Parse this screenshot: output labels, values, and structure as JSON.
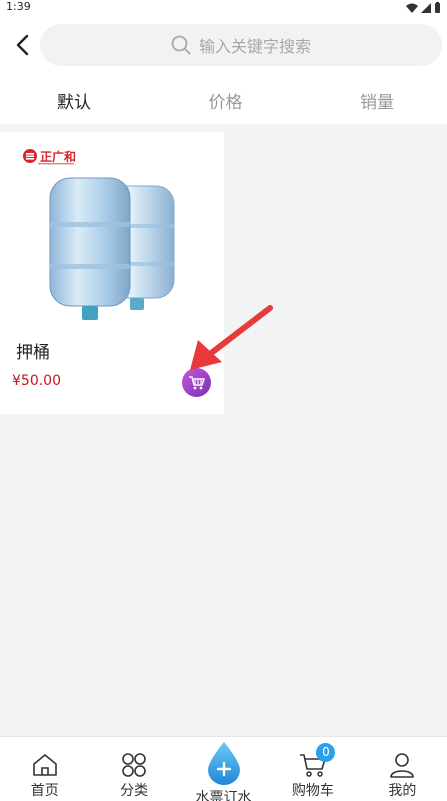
{
  "status_bar": {
    "time": "1:39"
  },
  "header": {
    "search_placeholder": "输入关键字搜索"
  },
  "tabs": [
    {
      "label": "默认",
      "active": true
    },
    {
      "label": "价格",
      "active": false
    },
    {
      "label": "销量",
      "active": false
    }
  ],
  "products": [
    {
      "name": "押桶",
      "price": "¥50.00",
      "brand_logo": "正广和"
    }
  ],
  "bottom_nav": {
    "home": "首页",
    "category": "分类",
    "water_ticket": "水票订水",
    "cart": "购物车",
    "cart_count": "0",
    "mine": "我的"
  },
  "colors": {
    "price": "#c8161d",
    "cart_button": "#9a3fc4",
    "badge": "#2aa0e8",
    "pointer": "#e83a3a"
  }
}
